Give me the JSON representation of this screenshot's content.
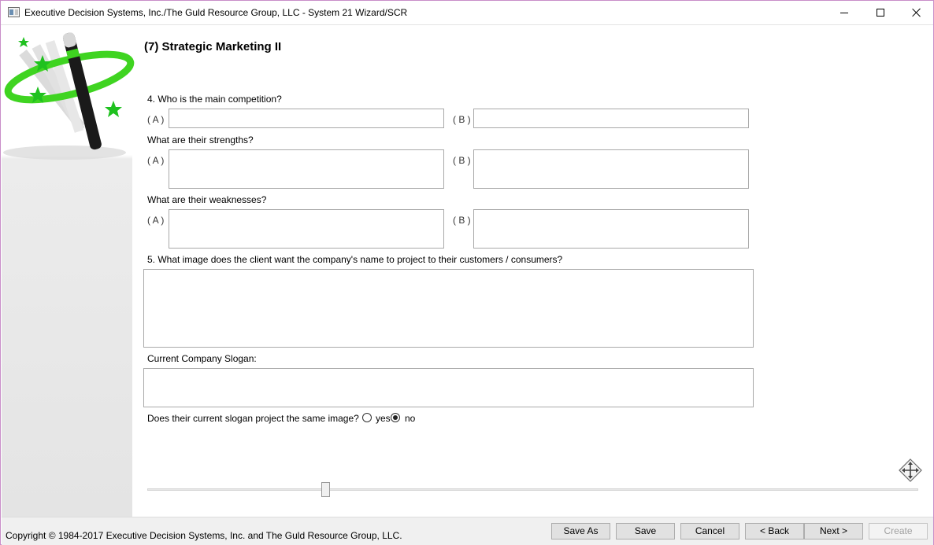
{
  "window": {
    "title": "Executive Decision Systems, Inc./The Guld Resource Group, LLC - System 21 Wizard/SCR"
  },
  "page": {
    "title": "(7) Strategic Marketing II"
  },
  "competition": {
    "question": "4. Who is the main competition?",
    "label_a": "( A )",
    "label_b": "( B )",
    "value_a": "",
    "value_b": ""
  },
  "strengths": {
    "question": "What are their strengths?",
    "label_a": "( A )",
    "label_b": "( B )",
    "value_a": "",
    "value_b": ""
  },
  "weaknesses": {
    "question": "What are their weaknesses?",
    "label_a": "( A )",
    "label_b": "( B )",
    "value_a": "",
    "value_b": ""
  },
  "image": {
    "question": "5. What image does the client want the company's name to project to their customers / consumers?",
    "value": ""
  },
  "slogan": {
    "label": "Current Company Slogan:",
    "value": ""
  },
  "slogan_image": {
    "question": "Does their current slogan project the same image?",
    "option_yes": "yes",
    "option_no": "no",
    "selected": "no"
  },
  "slider": {
    "value_fraction": 0.23
  },
  "icons": {
    "app": "app-window-icon",
    "logo": "magic-wand-icon",
    "move": "move-arrows-icon"
  },
  "footer": {
    "copyright": "Copyright © 1984-2017 Executive Decision Systems, Inc. and The Guld Resource Group, LLC.",
    "save_as": "Save As",
    "save": "Save",
    "cancel": "Cancel",
    "back": "< Back",
    "next": "Next >",
    "create": "Create"
  },
  "colors": {
    "window_border": "#c98ec9",
    "wand_green": "#3fd421",
    "panel_gray": "#e4e4e4"
  }
}
